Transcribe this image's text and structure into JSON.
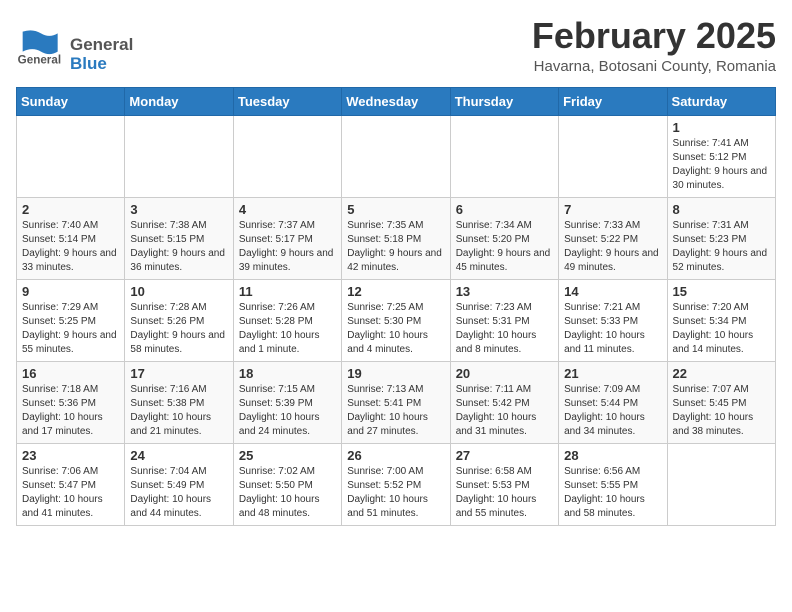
{
  "header": {
    "logo": {
      "general": "General",
      "blue": "Blue"
    },
    "title": "February 2025",
    "location": "Havarna, Botosani County, Romania"
  },
  "weekdays": [
    "Sunday",
    "Monday",
    "Tuesday",
    "Wednesday",
    "Thursday",
    "Friday",
    "Saturday"
  ],
  "weeks": [
    [
      null,
      null,
      null,
      null,
      null,
      null,
      {
        "day": "1",
        "sunrise": "Sunrise: 7:41 AM",
        "sunset": "Sunset: 5:12 PM",
        "daylight": "Daylight: 9 hours and 30 minutes."
      }
    ],
    [
      {
        "day": "2",
        "sunrise": "Sunrise: 7:40 AM",
        "sunset": "Sunset: 5:14 PM",
        "daylight": "Daylight: 9 hours and 33 minutes."
      },
      {
        "day": "3",
        "sunrise": "Sunrise: 7:38 AM",
        "sunset": "Sunset: 5:15 PM",
        "daylight": "Daylight: 9 hours and 36 minutes."
      },
      {
        "day": "4",
        "sunrise": "Sunrise: 7:37 AM",
        "sunset": "Sunset: 5:17 PM",
        "daylight": "Daylight: 9 hours and 39 minutes."
      },
      {
        "day": "5",
        "sunrise": "Sunrise: 7:35 AM",
        "sunset": "Sunset: 5:18 PM",
        "daylight": "Daylight: 9 hours and 42 minutes."
      },
      {
        "day": "6",
        "sunrise": "Sunrise: 7:34 AM",
        "sunset": "Sunset: 5:20 PM",
        "daylight": "Daylight: 9 hours and 45 minutes."
      },
      {
        "day": "7",
        "sunrise": "Sunrise: 7:33 AM",
        "sunset": "Sunset: 5:22 PM",
        "daylight": "Daylight: 9 hours and 49 minutes."
      },
      {
        "day": "8",
        "sunrise": "Sunrise: 7:31 AM",
        "sunset": "Sunset: 5:23 PM",
        "daylight": "Daylight: 9 hours and 52 minutes."
      }
    ],
    [
      {
        "day": "9",
        "sunrise": "Sunrise: 7:29 AM",
        "sunset": "Sunset: 5:25 PM",
        "daylight": "Daylight: 9 hours and 55 minutes."
      },
      {
        "day": "10",
        "sunrise": "Sunrise: 7:28 AM",
        "sunset": "Sunset: 5:26 PM",
        "daylight": "Daylight: 9 hours and 58 minutes."
      },
      {
        "day": "11",
        "sunrise": "Sunrise: 7:26 AM",
        "sunset": "Sunset: 5:28 PM",
        "daylight": "Daylight: 10 hours and 1 minute."
      },
      {
        "day": "12",
        "sunrise": "Sunrise: 7:25 AM",
        "sunset": "Sunset: 5:30 PM",
        "daylight": "Daylight: 10 hours and 4 minutes."
      },
      {
        "day": "13",
        "sunrise": "Sunrise: 7:23 AM",
        "sunset": "Sunset: 5:31 PM",
        "daylight": "Daylight: 10 hours and 8 minutes."
      },
      {
        "day": "14",
        "sunrise": "Sunrise: 7:21 AM",
        "sunset": "Sunset: 5:33 PM",
        "daylight": "Daylight: 10 hours and 11 minutes."
      },
      {
        "day": "15",
        "sunrise": "Sunrise: 7:20 AM",
        "sunset": "Sunset: 5:34 PM",
        "daylight": "Daylight: 10 hours and 14 minutes."
      }
    ],
    [
      {
        "day": "16",
        "sunrise": "Sunrise: 7:18 AM",
        "sunset": "Sunset: 5:36 PM",
        "daylight": "Daylight: 10 hours and 17 minutes."
      },
      {
        "day": "17",
        "sunrise": "Sunrise: 7:16 AM",
        "sunset": "Sunset: 5:38 PM",
        "daylight": "Daylight: 10 hours and 21 minutes."
      },
      {
        "day": "18",
        "sunrise": "Sunrise: 7:15 AM",
        "sunset": "Sunset: 5:39 PM",
        "daylight": "Daylight: 10 hours and 24 minutes."
      },
      {
        "day": "19",
        "sunrise": "Sunrise: 7:13 AM",
        "sunset": "Sunset: 5:41 PM",
        "daylight": "Daylight: 10 hours and 27 minutes."
      },
      {
        "day": "20",
        "sunrise": "Sunrise: 7:11 AM",
        "sunset": "Sunset: 5:42 PM",
        "daylight": "Daylight: 10 hours and 31 minutes."
      },
      {
        "day": "21",
        "sunrise": "Sunrise: 7:09 AM",
        "sunset": "Sunset: 5:44 PM",
        "daylight": "Daylight: 10 hours and 34 minutes."
      },
      {
        "day": "22",
        "sunrise": "Sunrise: 7:07 AM",
        "sunset": "Sunset: 5:45 PM",
        "daylight": "Daylight: 10 hours and 38 minutes."
      }
    ],
    [
      {
        "day": "23",
        "sunrise": "Sunrise: 7:06 AM",
        "sunset": "Sunset: 5:47 PM",
        "daylight": "Daylight: 10 hours and 41 minutes."
      },
      {
        "day": "24",
        "sunrise": "Sunrise: 7:04 AM",
        "sunset": "Sunset: 5:49 PM",
        "daylight": "Daylight: 10 hours and 44 minutes."
      },
      {
        "day": "25",
        "sunrise": "Sunrise: 7:02 AM",
        "sunset": "Sunset: 5:50 PM",
        "daylight": "Daylight: 10 hours and 48 minutes."
      },
      {
        "day": "26",
        "sunrise": "Sunrise: 7:00 AM",
        "sunset": "Sunset: 5:52 PM",
        "daylight": "Daylight: 10 hours and 51 minutes."
      },
      {
        "day": "27",
        "sunrise": "Sunrise: 6:58 AM",
        "sunset": "Sunset: 5:53 PM",
        "daylight": "Daylight: 10 hours and 55 minutes."
      },
      {
        "day": "28",
        "sunrise": "Sunrise: 6:56 AM",
        "sunset": "Sunset: 5:55 PM",
        "daylight": "Daylight: 10 hours and 58 minutes."
      },
      null
    ]
  ]
}
